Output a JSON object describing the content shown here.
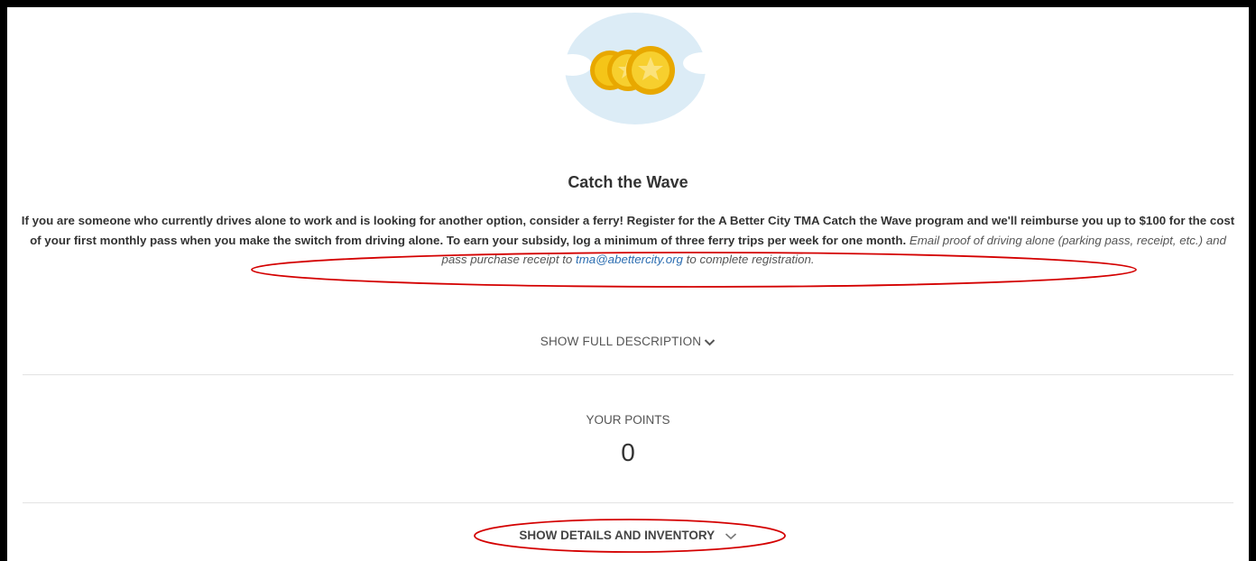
{
  "program": {
    "title": "Catch the Wave",
    "description_main": "If you are someone who currently drives alone to work and is looking for another option, consider a ferry! Register for the A Better City TMA Catch the Wave program and we'll reimburse you up to $100 for the cost of your first monthly pass when you make the switch from driving alone. To earn your subsidy, log a minimum of three ferry trips per week for one month.",
    "description_emphasis": "Email proof of driving alone (parking pass, receipt, etc.) and pass purchase receipt to",
    "email": "tma@abettercity.org",
    "description_tail": "to complete registration.",
    "show_full_label": "SHOW FULL DESCRIPTION"
  },
  "points": {
    "label": "YOUR POINTS",
    "value": "0"
  },
  "details": {
    "show_label": "SHOW DETAILS AND INVENTORY"
  },
  "colors": {
    "link": "#2a6cb0",
    "annotation": "#d40000",
    "coin": "#f5c518",
    "cloud": "#dcecf6"
  }
}
